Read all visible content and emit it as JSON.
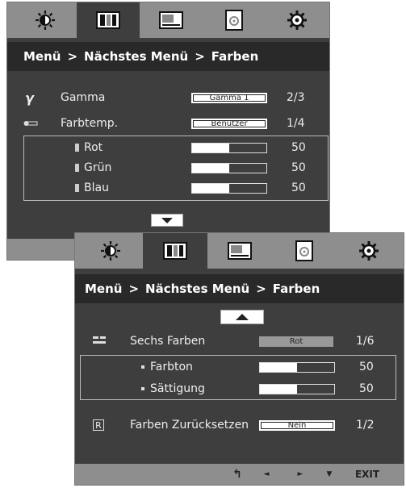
{
  "tabs": [
    {
      "icon": "brightness-icon"
    },
    {
      "icon": "color-bars-icon"
    },
    {
      "icon": "picture-icon"
    },
    {
      "icon": "sound-icon"
    },
    {
      "icon": "settings-gear-icon"
    }
  ],
  "menu1": {
    "breadcrumb": [
      "Menü",
      ">",
      "Nächstes Menü",
      ">",
      "Farben"
    ],
    "gamma": {
      "icon": "gamma-icon",
      "label": "Gamma",
      "value": "Gamma 1",
      "count": "2/3"
    },
    "farbtemp": {
      "icon": "thermometer-icon",
      "label": "Farbtemp.",
      "value": "Benutzer",
      "count": "1/4"
    },
    "rgb": [
      {
        "label": "Rot",
        "value": "50",
        "level": 0.5
      },
      {
        "label": "Grün",
        "value": "50",
        "level": 0.5
      },
      {
        "label": "Blau",
        "value": "50",
        "level": 0.5
      }
    ],
    "nav": {
      "icon": "arrow-down-icon"
    }
  },
  "menu2": {
    "breadcrumb": [
      "Menü",
      ">",
      "Nächstes Menü",
      ">",
      "Farben"
    ],
    "nav": {
      "icon": "arrow-up-icon"
    },
    "sechs": {
      "icon": "six-colors-icon",
      "label": "Sechs Farben",
      "value": "Rot",
      "count": "1/6"
    },
    "sub": [
      {
        "label": "Farbton",
        "value": "50",
        "level": 0.5
      },
      {
        "label": "Sättigung",
        "value": "50",
        "level": 0.5
      }
    ],
    "reset": {
      "icon": "reset-r-icon",
      "label": "Farben Zurücksetzen",
      "value": "Nein",
      "count": "1/2"
    },
    "footer": [
      {
        "icon": "back-icon",
        "label": "↰"
      },
      {
        "icon": "left-arrow-icon",
        "label": "◄"
      },
      {
        "icon": "right-arrow-icon",
        "label": "►"
      },
      {
        "icon": "down-arrow-icon",
        "label": "▼"
      },
      {
        "label": "EXIT"
      }
    ]
  },
  "colors": {
    "panel": "#3e3e3e",
    "tabbar": "#8e8e8e",
    "crumb": "#292929"
  }
}
